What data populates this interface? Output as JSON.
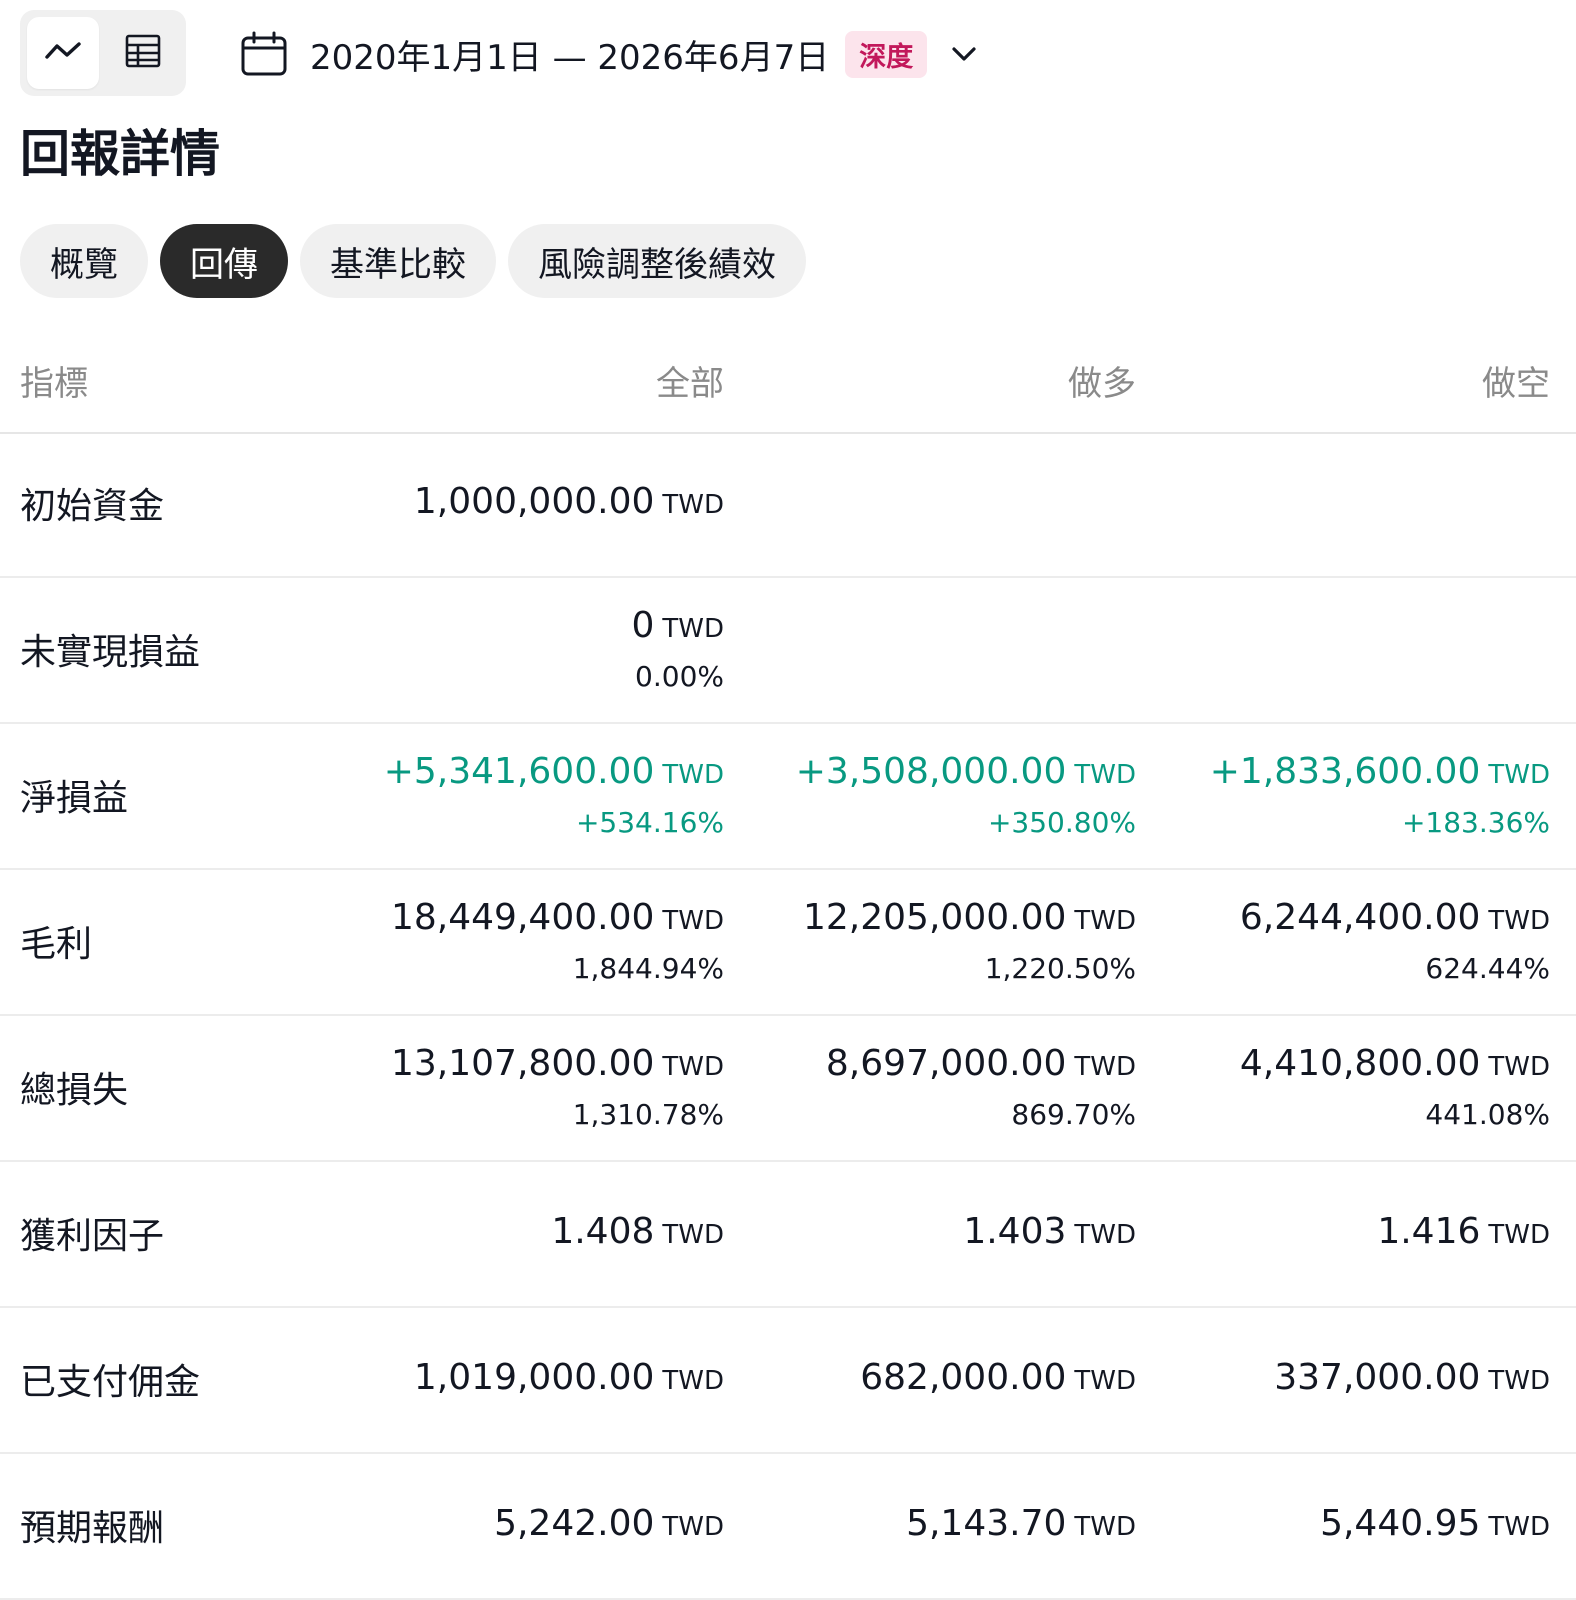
{
  "toolbar": {
    "date_range": "2020年1月1日 — 2026年6月7日",
    "badge": "深度",
    "badge_bg": "#fce4ec",
    "badge_color": "#c2185b",
    "icons": [
      "line-chart-icon",
      "table-icon",
      "calendar-icon",
      "chevron-down-icon"
    ]
  },
  "title": "回報詳情",
  "tabs": [
    {
      "label": "概覽",
      "active": false
    },
    {
      "label": "回傳",
      "active": true
    },
    {
      "label": "基準比較",
      "active": false
    },
    {
      "label": "風險調整後績效",
      "active": false
    }
  ],
  "table": {
    "headers": {
      "metric": "指標",
      "all": "全部",
      "long": "做多",
      "short": "做空"
    },
    "unit": "TWD",
    "rows": [
      {
        "label": "初始資金",
        "all": {
          "value": "1,000,000.00"
        }
      },
      {
        "label": "未實現損益",
        "all": {
          "value": "0",
          "pct": "0.00%"
        }
      },
      {
        "label": "淨損益",
        "positive": true,
        "all": {
          "value": "+5,341,600.00",
          "pct": "+534.16%"
        },
        "long": {
          "value": "+3,508,000.00",
          "pct": "+350.80%"
        },
        "short": {
          "value": "+1,833,600.00",
          "pct": "+183.36%"
        }
      },
      {
        "label": "毛利",
        "all": {
          "value": "18,449,400.00",
          "pct": "1,844.94%"
        },
        "long": {
          "value": "12,205,000.00",
          "pct": "1,220.50%"
        },
        "short": {
          "value": "6,244,400.00",
          "pct": "624.44%"
        }
      },
      {
        "label": "總損失",
        "all": {
          "value": "13,107,800.00",
          "pct": "1,310.78%"
        },
        "long": {
          "value": "8,697,000.00",
          "pct": "869.70%"
        },
        "short": {
          "value": "4,410,800.00",
          "pct": "441.08%"
        }
      },
      {
        "label": "獲利因子",
        "all": {
          "value": "1.408"
        },
        "long": {
          "value": "1.403"
        },
        "short": {
          "value": "1.416"
        }
      },
      {
        "label": "已支付佣金",
        "all": {
          "value": "1,019,000.00"
        },
        "long": {
          "value": "682,000.00"
        },
        "short": {
          "value": "337,000.00"
        }
      },
      {
        "label": "預期報酬",
        "all": {
          "value": "5,242.00"
        },
        "long": {
          "value": "5,143.70"
        },
        "short": {
          "value": "5,440.95"
        }
      }
    ],
    "positive_color": "#089981"
  }
}
